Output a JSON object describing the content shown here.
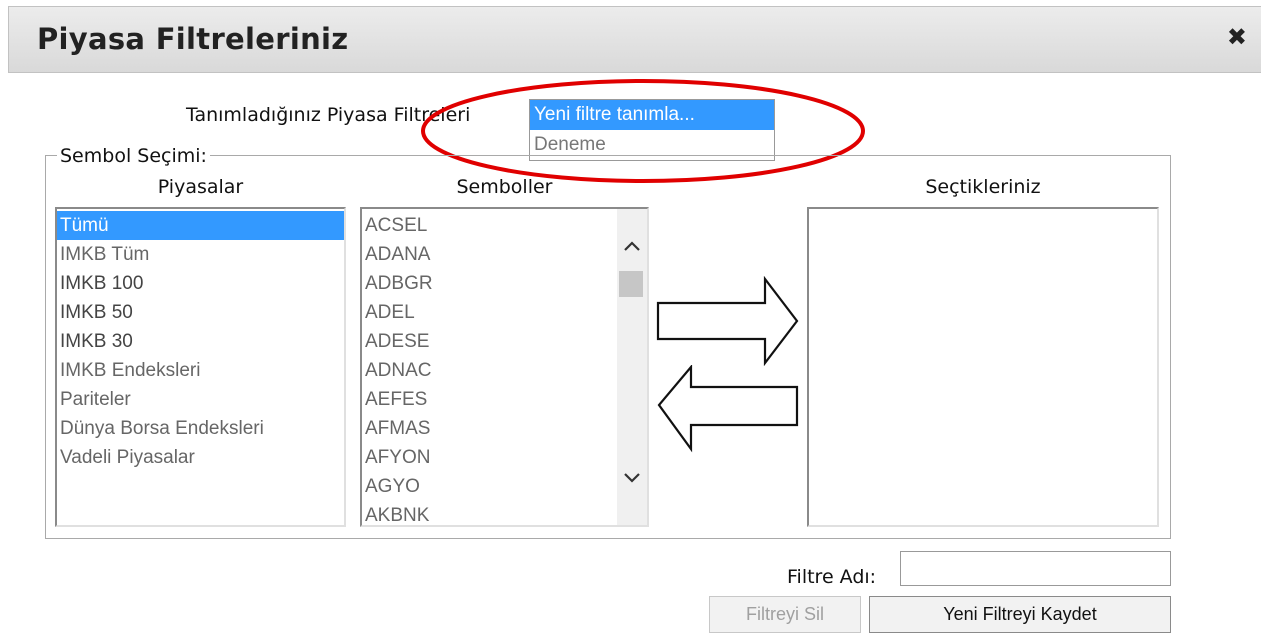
{
  "dialog": {
    "title": "Piyasa Filtreleriniz",
    "close_icon": "close-icon"
  },
  "filters": {
    "label": "Tanımladığınız Piyasa Filtreleri",
    "options": [
      "Yeni filtre tanımla...",
      "Deneme"
    ],
    "selected": "Yeni filtre tanımla..."
  },
  "symbol_selection": {
    "legend": "Sembol Seçimi:",
    "markets_header": "Piyasalar",
    "symbols_header": "Semboller",
    "selected_header": "Seçtikleriniz",
    "markets": [
      "Tümü",
      "IMKB Tüm",
      "IMKB 100",
      "IMKB 50",
      "IMKB 30",
      "IMKB Endeksleri",
      "Pariteler",
      "Dünya Borsa Endeksleri",
      "Vadeli Piyasalar"
    ],
    "markets_selected": "Tümü",
    "symbols": [
      "ACSEL",
      "ADANA",
      "ADBGR",
      "ADEL",
      "ADESE",
      "ADNAC",
      "AEFES",
      "AFMAS",
      "AFYON",
      "AGYO",
      "AKBNK"
    ],
    "selected_items": [],
    "add_arrow_icon": "arrow-right-icon",
    "remove_arrow_icon": "arrow-left-icon"
  },
  "form": {
    "name_label": "Filtre Adı:",
    "name_value": "",
    "delete_button": "Filtreyi Sil",
    "save_button": "Yeni Filtreyi Kaydet"
  },
  "colors": {
    "selection": "#3399ff",
    "annotation": "#e00000"
  }
}
